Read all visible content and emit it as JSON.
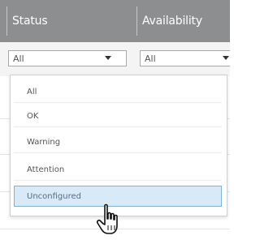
{
  "table": {
    "columns": [
      {
        "label": "Status"
      },
      {
        "label": "Availability"
      }
    ],
    "filters": {
      "status": {
        "selected": "All"
      },
      "availability": {
        "selected": "All"
      }
    }
  },
  "dropdown": {
    "options": [
      {
        "label": "All"
      },
      {
        "label": "OK"
      },
      {
        "label": "Warning"
      },
      {
        "label": "Attention"
      },
      {
        "label": "Unconfigured"
      }
    ],
    "highlighted_index": 4
  },
  "cursor": {
    "icon": "hand-pointer-icon"
  },
  "colors": {
    "header_bg": "#8d8e90",
    "highlight_bg": "#d8e9f8",
    "highlight_border": "#7fb2d9"
  }
}
